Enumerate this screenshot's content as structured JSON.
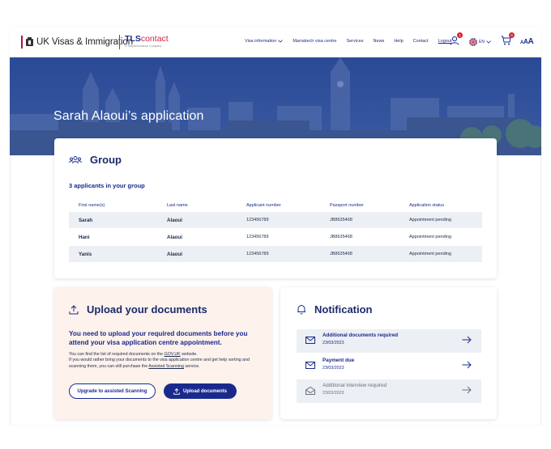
{
  "header": {
    "logo_uk_text": "UK Visas & Immigration",
    "logo_tls_part1": "TLS",
    "logo_tls_part2": "contact",
    "logo_tls_sub": "A Teleperformance Company",
    "nav": [
      {
        "label": "Visa information",
        "has_dropdown": true
      },
      {
        "label": "Marrakech visa centre"
      },
      {
        "label": "Services"
      },
      {
        "label": "News"
      },
      {
        "label": "Help"
      },
      {
        "label": "Contact"
      },
      {
        "label": "Logout"
      }
    ],
    "user_badge": "1",
    "lang": "EN",
    "cart_badge": "0",
    "text_size_label": "AAA"
  },
  "hero": {
    "title": "Sarah Alaoui’s application"
  },
  "group": {
    "title": "Group",
    "count_text": "3 applicants in your group",
    "columns": [
      "First name(s)",
      "Last name",
      "Applicant number",
      "Passport number",
      "Application status"
    ],
    "rows": [
      {
        "first": "Sarah",
        "last": "Alaoui",
        "applicant": "123456789",
        "passport": "JB8635468",
        "status": "Appointment pending"
      },
      {
        "first": "Hani",
        "last": "Alaoui",
        "applicant": "123456789",
        "passport": "JB8635468",
        "status": "Appointment pending"
      },
      {
        "first": "Yanis",
        "last": "Alaoui",
        "applicant": "123456789",
        "passport": "JB8635468",
        "status": "Appointment pending"
      }
    ]
  },
  "upload": {
    "title": "Upload your documents",
    "message": "You need to upload your required documents before you attend your visa application centre appointment.",
    "detail_1": "You can find the list of required documents on the ",
    "detail_link_1": "GOV.UK",
    "detail_2": " website.",
    "detail_3": "If you would rather bring your documents to the visa application centre and get help sorting and scanning them, you can still purchase the ",
    "detail_link_2": "Assisted Scanning",
    "detail_4": " service.",
    "btn_assisted": "Upgrade to assisted Scanning",
    "btn_upload": "Upload documents"
  },
  "notification": {
    "title": "Notification",
    "items": [
      {
        "title": "Additional documents required",
        "date": "23/03/2023",
        "state": "unread"
      },
      {
        "title": "Payment due",
        "date": "23/03/2023",
        "state": "unread"
      },
      {
        "title": "Additional interview required",
        "date": "23/03/2023",
        "state": "read"
      }
    ]
  },
  "colors": {
    "brand_blue": "#1a2a8c",
    "hero_overlay": "#2e4a8f",
    "upload_bg": "#fdf2ec",
    "badge_red": "#d52230"
  }
}
